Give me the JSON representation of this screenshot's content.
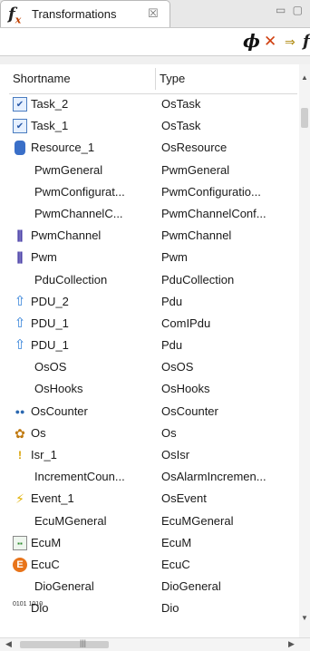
{
  "tab": {
    "title": "Transformations",
    "fx_symbol": "f",
    "fx_sub": "x",
    "close_glyph": "☒",
    "minmax_glyph": "▭ ▢"
  },
  "toolbar": {
    "phi": "ϕ",
    "split": "✕",
    "arrows": "⇒",
    "fx": "f"
  },
  "columns": {
    "shortname": "Shortname",
    "type": "Type"
  },
  "rows": [
    {
      "name": "Task_2",
      "type": "OsTask",
      "icon": "task-icon",
      "glyph": "✔"
    },
    {
      "name": "Task_1",
      "type": "OsTask",
      "icon": "task-icon",
      "glyph": "✔"
    },
    {
      "name": "Resource_1",
      "type": "OsResource",
      "icon": "resource-icon",
      "glyph": ""
    },
    {
      "name": "PwmGeneral",
      "type": "PwmGeneral",
      "icon": "",
      "glyph": ""
    },
    {
      "name": "PwmConfigurat...",
      "type": "PwmConfiguratio...",
      "icon": "",
      "glyph": ""
    },
    {
      "name": "PwmChannelC...",
      "type": "PwmChannelConf...",
      "icon": "",
      "glyph": ""
    },
    {
      "name": "PwmChannel",
      "type": "PwmChannel",
      "icon": "pwm-icon",
      "glyph": "⫼"
    },
    {
      "name": "Pwm",
      "type": "Pwm",
      "icon": "pwm-icon",
      "glyph": "⫼"
    },
    {
      "name": "PduCollection",
      "type": "PduCollection",
      "icon": "",
      "glyph": ""
    },
    {
      "name": "PDU_2",
      "type": "Pdu",
      "icon": "pdu-icon",
      "glyph": "⇧"
    },
    {
      "name": "PDU_1",
      "type": "ComIPdu",
      "icon": "pdu-icon",
      "glyph": "⇧"
    },
    {
      "name": "PDU_1",
      "type": "Pdu",
      "icon": "pdu-icon",
      "glyph": "⇧"
    },
    {
      "name": "OsOS",
      "type": "OsOS",
      "icon": "",
      "glyph": ""
    },
    {
      "name": "OsHooks",
      "type": "OsHooks",
      "icon": "",
      "glyph": ""
    },
    {
      "name": "OsCounter",
      "type": "OsCounter",
      "icon": "counter-icon",
      "glyph": "●●"
    },
    {
      "name": "Os",
      "type": "Os",
      "icon": "os-icon",
      "glyph": "✿"
    },
    {
      "name": "Isr_1",
      "type": "OsIsr",
      "icon": "isr-icon",
      "glyph": "!"
    },
    {
      "name": "IncrementCoun...",
      "type": "OsAlarmIncremen...",
      "icon": "",
      "glyph": ""
    },
    {
      "name": "Event_1",
      "type": "OsEvent",
      "icon": "event-icon",
      "glyph": "⚡"
    },
    {
      "name": "EcuMGeneral",
      "type": "EcuMGeneral",
      "icon": "",
      "glyph": ""
    },
    {
      "name": "EcuM",
      "type": "EcuM",
      "icon": "ecum-icon",
      "glyph": "▪▪"
    },
    {
      "name": "EcuC",
      "type": "EcuC",
      "icon": "ecuc-icon",
      "glyph": "E"
    },
    {
      "name": "DioGeneral",
      "type": "DioGeneral",
      "icon": "",
      "glyph": ""
    },
    {
      "name": "Dio",
      "type": "Dio",
      "icon": "dio-icon",
      "glyph": "0101 1010"
    }
  ],
  "colors": {
    "accent_fx": "#c04000",
    "ecuc": "#e8741a",
    "pdu": "#2f7fd8",
    "pwm": "#3a2fa0"
  }
}
